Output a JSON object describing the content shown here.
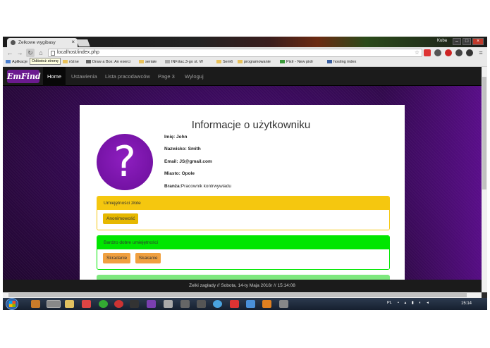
{
  "browser": {
    "tab_title": "Zelkowe wygibasy",
    "url": "localhost/index.php",
    "tooltip": "Odśwież stronę",
    "user": "Kuba",
    "bookmarks": [
      "Aplikacje",
      "różne",
      "Draw a Box: An exerci",
      "seriale",
      "INF.itac.3-go st. W",
      "Sem6",
      "programowanie",
      "Pixlr - New pixlr",
      "hosting index"
    ]
  },
  "navbar": {
    "brand": "EmFind",
    "items": [
      "Home",
      "Ustawienia",
      "Lista pracodawców",
      "Page 3",
      "Wyloguj"
    ]
  },
  "profile": {
    "title": "Informacje o użytkowniku",
    "avatar_glyph": "?",
    "fields": [
      {
        "label": "Imię:",
        "value": "John"
      },
      {
        "label": "Nazwisko:",
        "value": "Smith"
      },
      {
        "label": "Email:",
        "value": "JS@gmail.com"
      },
      {
        "label": "Miasto:",
        "value": "Opole"
      },
      {
        "label": "Branża:",
        "value": "Pracownik kontrwywiadu"
      }
    ]
  },
  "skills": [
    {
      "heading": "Umiejętności złote",
      "color": "#f5c70f",
      "chips": [
        "Anonimowość"
      ],
      "chip_color": "#e6b800"
    },
    {
      "heading": "Bardzo dobre umiejętności",
      "color": "#00e600",
      "chips": [
        "Skradanie",
        "Skakanie"
      ],
      "chip_color": "#f0a040"
    }
  ],
  "footer": "Zelki zagłady // Sobota, 14-ty Maja 2016r // 15:14:08",
  "taskbar": {
    "lang": "PL",
    "clock": "15:14"
  }
}
